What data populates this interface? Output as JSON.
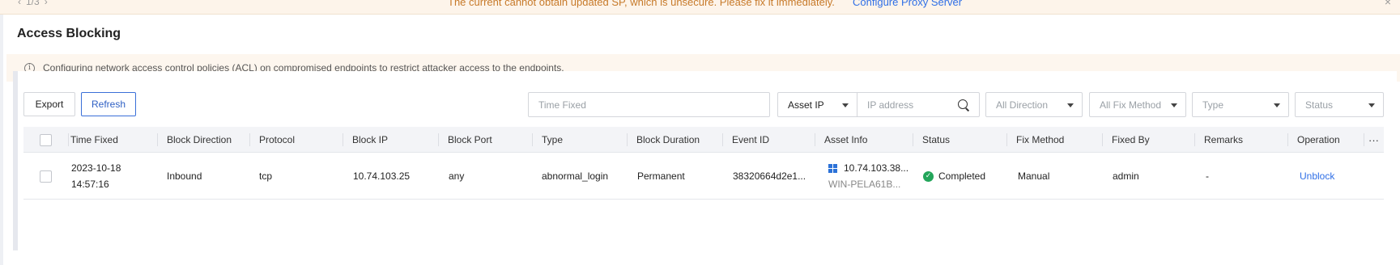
{
  "topbar": {
    "pager": "1/3",
    "alert_text": "The current cannot obtain updated SP, which is unsecure. Please fix it immediately.",
    "alert_link": "Configure Proxy Server",
    "close_icon": "close-icon"
  },
  "page": {
    "title": "Access Blocking",
    "info": "Configuring network access control policies (ACL) on compromised endpoints to restrict attacker access to the endpoints."
  },
  "toolbar": {
    "export_label": "Export",
    "refresh_label": "Refresh"
  },
  "filters": {
    "time_placeholder": "Time Fixed",
    "asset_select": "Asset IP",
    "ip_placeholder": "IP address",
    "direction": "All Direction",
    "fix_method": "All Fix Method",
    "type": "Type",
    "status": "Status"
  },
  "table": {
    "columns": [
      "Time Fixed",
      "Block Direction",
      "Protocol",
      "Block IP",
      "Block Port",
      "Type",
      "Block Duration",
      "Event ID",
      "Asset Info",
      "Status",
      "Fix Method",
      "Fixed By",
      "Remarks",
      "Operation"
    ],
    "rows": [
      {
        "time_date": "2023-10-18",
        "time_clock": "14:57:16",
        "direction": "Inbound",
        "protocol": "tcp",
        "block_ip": "10.74.103.25",
        "block_port": "any",
        "type": "abnormal_login",
        "duration": "Permanent",
        "event_id": "38320664d2e1...",
        "asset_ip": "10.74.103.38...",
        "asset_host": "WIN-PELA61B...",
        "status": "Completed",
        "fix_method": "Manual",
        "fixed_by": "admin",
        "remarks": "-",
        "operation": "Unblock"
      }
    ]
  },
  "colors": {
    "accent": "#2f6fe6",
    "success": "#23a55a",
    "warning_text": "#c77a2a"
  }
}
